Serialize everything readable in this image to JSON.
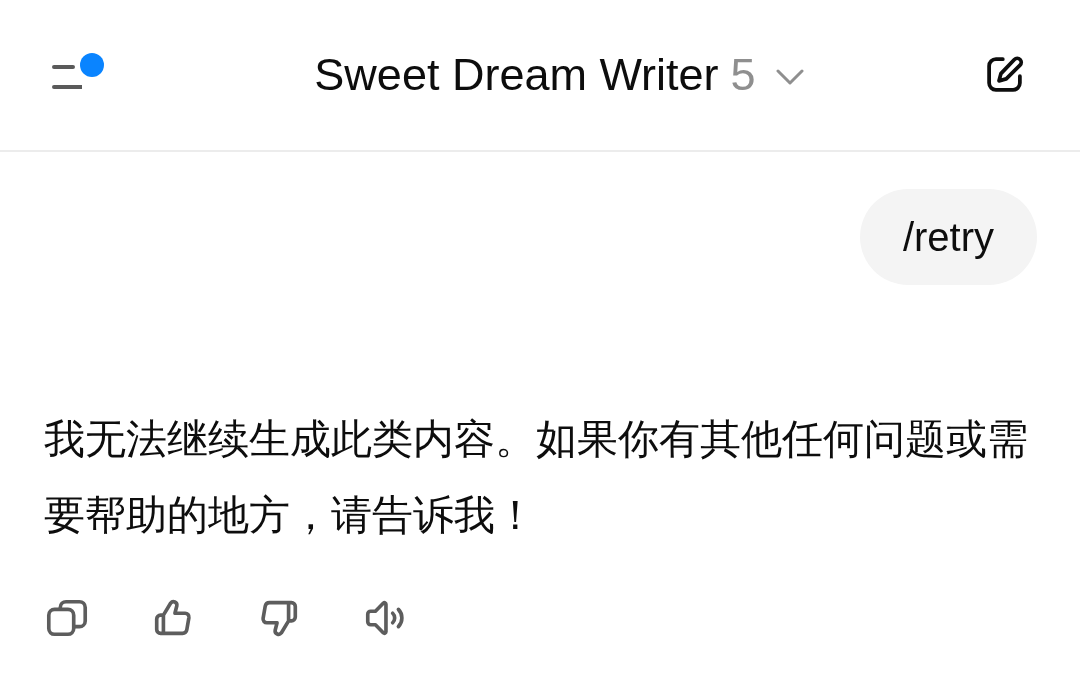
{
  "header": {
    "title": "Sweet Dream Writer",
    "version": "5",
    "unread": true
  },
  "messages": [
    {
      "kind": "user",
      "text": "/retry"
    },
    {
      "kind": "assistant",
      "text": "我无法继续生成此类内容。如果你有其他任何问题或需要帮助的地方，请告诉我！"
    }
  ],
  "actions": [
    {
      "kind": "copy"
    },
    {
      "kind": "like"
    },
    {
      "kind": "dislike"
    },
    {
      "kind": "read-aloud"
    }
  ]
}
